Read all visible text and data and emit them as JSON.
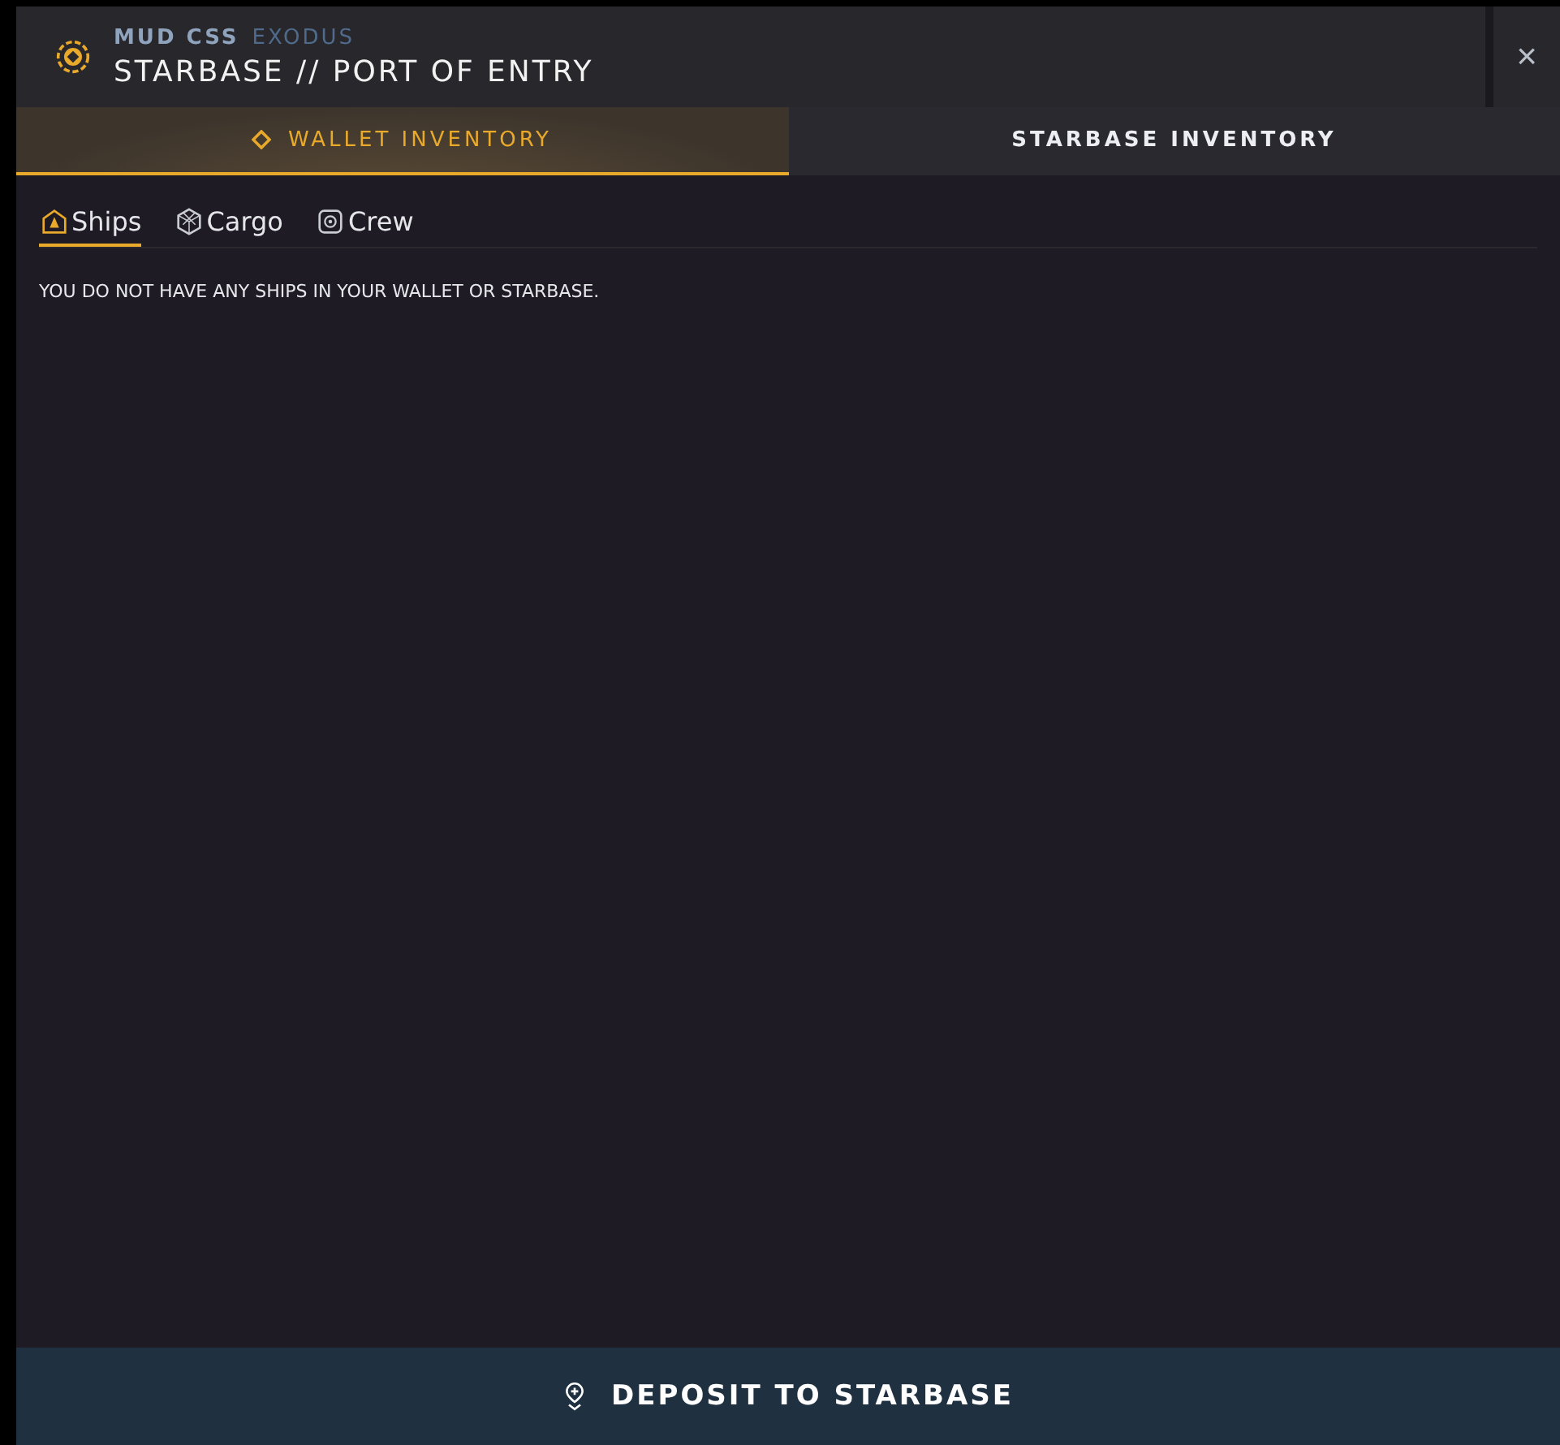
{
  "header": {
    "game": "MUD CSS",
    "faction": "EXODUS",
    "title": "STARBASE // PORT OF ENTRY",
    "close": "×"
  },
  "tabs": [
    {
      "label": "WALLET INVENTORY",
      "selected": true
    },
    {
      "label": "STARBASE INVENTORY",
      "selected": false
    }
  ],
  "subtabs": [
    {
      "label": "Ships",
      "kind": "ships",
      "selected": true
    },
    {
      "label": "Cargo",
      "kind": "cargo",
      "selected": false
    },
    {
      "label": "Crew",
      "kind": "crew",
      "selected": false
    }
  ],
  "message": "YOU DO NOT HAVE ANY SHIPS IN YOUR WALLET OR STARBASE.",
  "action": {
    "label": "DEPOSIT TO STARBASE"
  }
}
